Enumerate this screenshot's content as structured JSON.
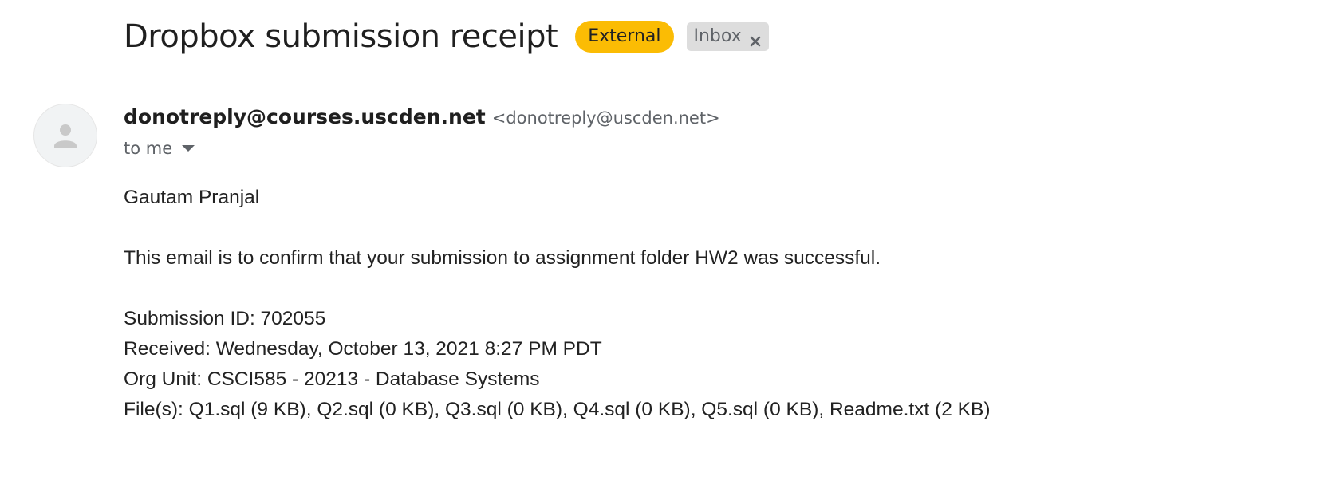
{
  "email": {
    "subject": "Dropbox submission receipt",
    "labels": {
      "external": "External",
      "inbox": "Inbox"
    },
    "sender": {
      "name": "donotreply@courses.uscden.net",
      "email": "<donotreply@uscden.net>"
    },
    "recipient": "to me",
    "body": {
      "greeting": "Gautam Pranjal",
      "confirmation": "This email is to confirm that your submission to assignment folder HW2 was successful.",
      "submission_id": "Submission ID: 702055",
      "received": "Received: Wednesday, October 13, 2021 8:27 PM PDT",
      "org_unit": "Org Unit: CSCI585 - 20213 - Database Systems",
      "files": "File(s): Q1.sql (9 KB), Q2.sql (0 KB), Q3.sql (0 KB), Q4.sql (0 KB), Q5.sql (0 KB), Readme.txt (2 KB)"
    }
  },
  "colors": {
    "external_label_bg": "#fbbc04",
    "inbox_label_bg": "#dddddd",
    "secondary_text": "#5f6368",
    "avatar_bg": "#f1f3f4"
  },
  "icons": {
    "avatar": "person-icon",
    "label_remove": "close-icon",
    "recipient_details": "caret-down-icon"
  }
}
